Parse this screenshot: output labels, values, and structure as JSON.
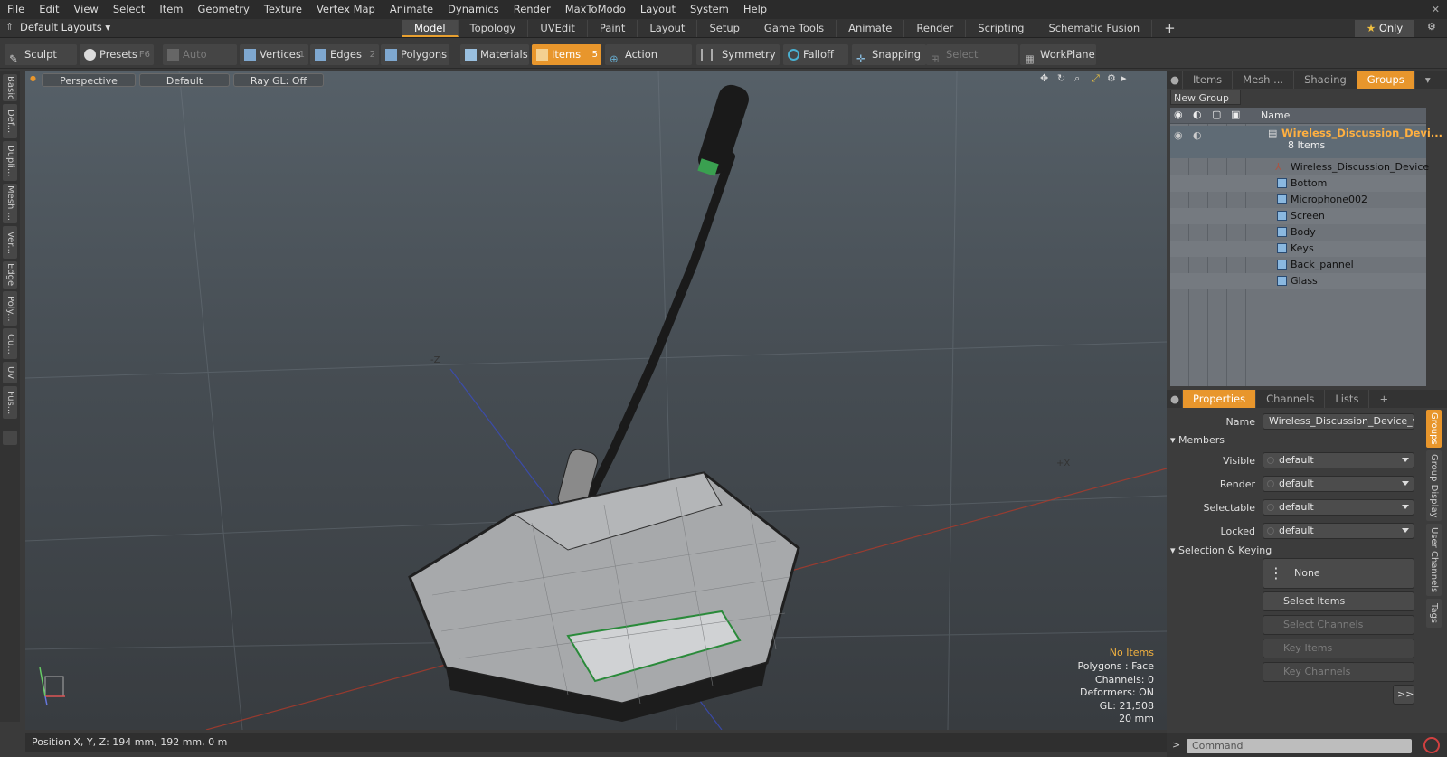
{
  "menu": [
    "File",
    "Edit",
    "View",
    "Select",
    "Item",
    "Geometry",
    "Texture",
    "Vertex Map",
    "Animate",
    "Dynamics",
    "Render",
    "MaxToModo",
    "Layout",
    "System",
    "Help"
  ],
  "layout_selector": "Default Layouts",
  "mode_tabs": [
    "Model",
    "Topology",
    "UVEdit",
    "Paint",
    "Layout",
    "Setup",
    "Game Tools",
    "Animate",
    "Render",
    "Scripting",
    "Schematic Fusion"
  ],
  "active_mode_tab": "Model",
  "only_button": "Only",
  "toolbar": {
    "sculpt": "Sculpt",
    "presets": "Presets",
    "presets_key": "F6",
    "auto_select": "Auto Select",
    "vertices": "Vertices",
    "vertices_key": "1",
    "edges": "Edges",
    "edges_key": "2",
    "polygons": "Polygons",
    "materials": "Materials",
    "items": "Items",
    "items_key": "5",
    "action_center": "Action Center",
    "symmetry": "Symmetry",
    "falloff": "Falloff",
    "snapping": "Snapping",
    "select_through": "Select Through",
    "workplane": "WorkPlane"
  },
  "left_tabs": [
    "Basic",
    "Def...",
    "Dupli...",
    "Mesh ...",
    "Ver...",
    "Edge",
    "Poly...",
    "Cu...",
    "UV",
    "Fus..."
  ],
  "viewport": {
    "view": "Perspective",
    "shading": "Default",
    "raygl": "Ray GL: Off",
    "info": {
      "no_items": "No Items",
      "polygons": "Polygons : Face",
      "channels": "Channels: 0",
      "deformers": "Deformers: ON",
      "gl": "GL: 21,508",
      "scale": "20 mm"
    }
  },
  "status": "Position X, Y, Z:  194 mm, 192 mm, 0 m",
  "right_tabs": [
    "Items",
    "Mesh ...",
    "Shading",
    "Groups"
  ],
  "active_right_tab": "Groups",
  "new_group": "New Group",
  "tree": {
    "name_header": "Name",
    "group_name": "Wireless_Discussion_Devi...",
    "group_count": "8 Items",
    "items": [
      "Wireless_Discussion_Device ...",
      "Bottom",
      "Microphone002",
      "Screen",
      "Body",
      "Keys",
      "Back_pannel",
      "Glass"
    ]
  },
  "prop_tabs": [
    "Properties",
    "Channels",
    "Lists"
  ],
  "properties": {
    "name_label": "Name",
    "name_value": "Wireless_Discussion_Device_with",
    "members": "Members",
    "visible_label": "Visible",
    "visible": "default",
    "render_label": "Render",
    "render": "default",
    "selectable_label": "Selectable",
    "selectable": "default",
    "locked_label": "Locked",
    "locked": "default",
    "sel_keying": "Selection & Keying",
    "none": "None",
    "select_items": "Select Items",
    "select_channels": "Select Channels",
    "key_items": "Key Items",
    "key_channels": "Key Channels",
    "more": ">>"
  },
  "side_tabs": [
    "Groups",
    "Group Display",
    "User Channels",
    "Tags"
  ],
  "command_placeholder": "Command"
}
